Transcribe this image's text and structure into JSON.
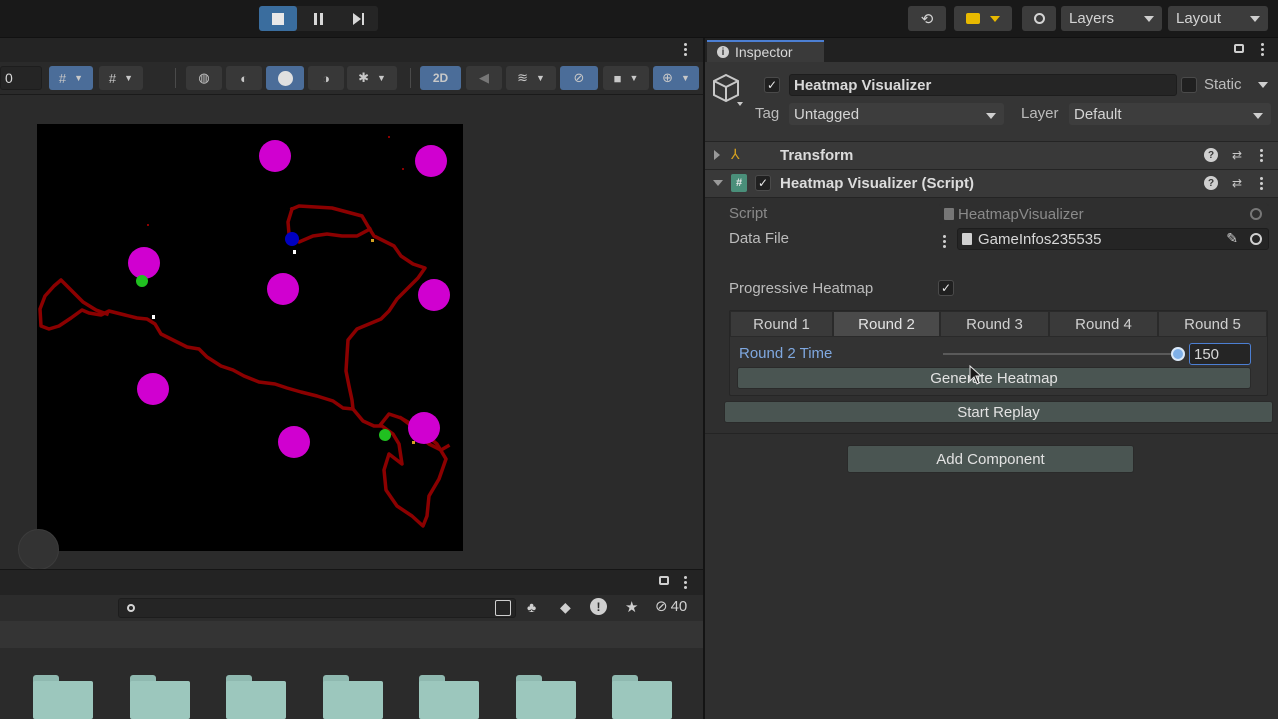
{
  "toolbar": {
    "layers_label": "Layers",
    "layout_label": "Layout",
    "play_icon": "stop-icon",
    "pause_icon": "pause-icon",
    "step_icon": "step-icon"
  },
  "scene": {
    "field_value": "0",
    "mode_2d_label": "2D",
    "heatmap_colors": {
      "background": "#000000",
      "path": "#8b0000",
      "pickup": "#d000d0",
      "player": "#0000c0",
      "goal": "#20c020"
    }
  },
  "project": {
    "search_placeholder": "",
    "hidden_count": "40",
    "folder_count": 7
  },
  "inspector": {
    "tab_label": "Inspector",
    "object_name": "Heatmap Visualizer",
    "static_label": "Static",
    "tag_label": "Tag",
    "tag_value": "Untagged",
    "layer_label": "Layer",
    "layer_value": "Default",
    "transform_title": "Transform",
    "script_component_title": "Heatmap Visualizer (Script)",
    "script_label": "Script",
    "script_value": "HeatmapVisualizer",
    "data_file_label": "Data File",
    "data_file_value": "GameInfos235535",
    "progressive_label": "Progressive Heatmap",
    "round_tabs": [
      "Round 1",
      "Round 2",
      "Round 3",
      "Round 4",
      "Round 5"
    ],
    "active_round": "Round 2",
    "round_time_label": "Round 2 Time",
    "round_time_value": "150",
    "round_time_fraction": 1.0,
    "generate_label": "Generate Heatmap",
    "replay_label": "Start Replay",
    "add_component_label": "Add Component"
  }
}
